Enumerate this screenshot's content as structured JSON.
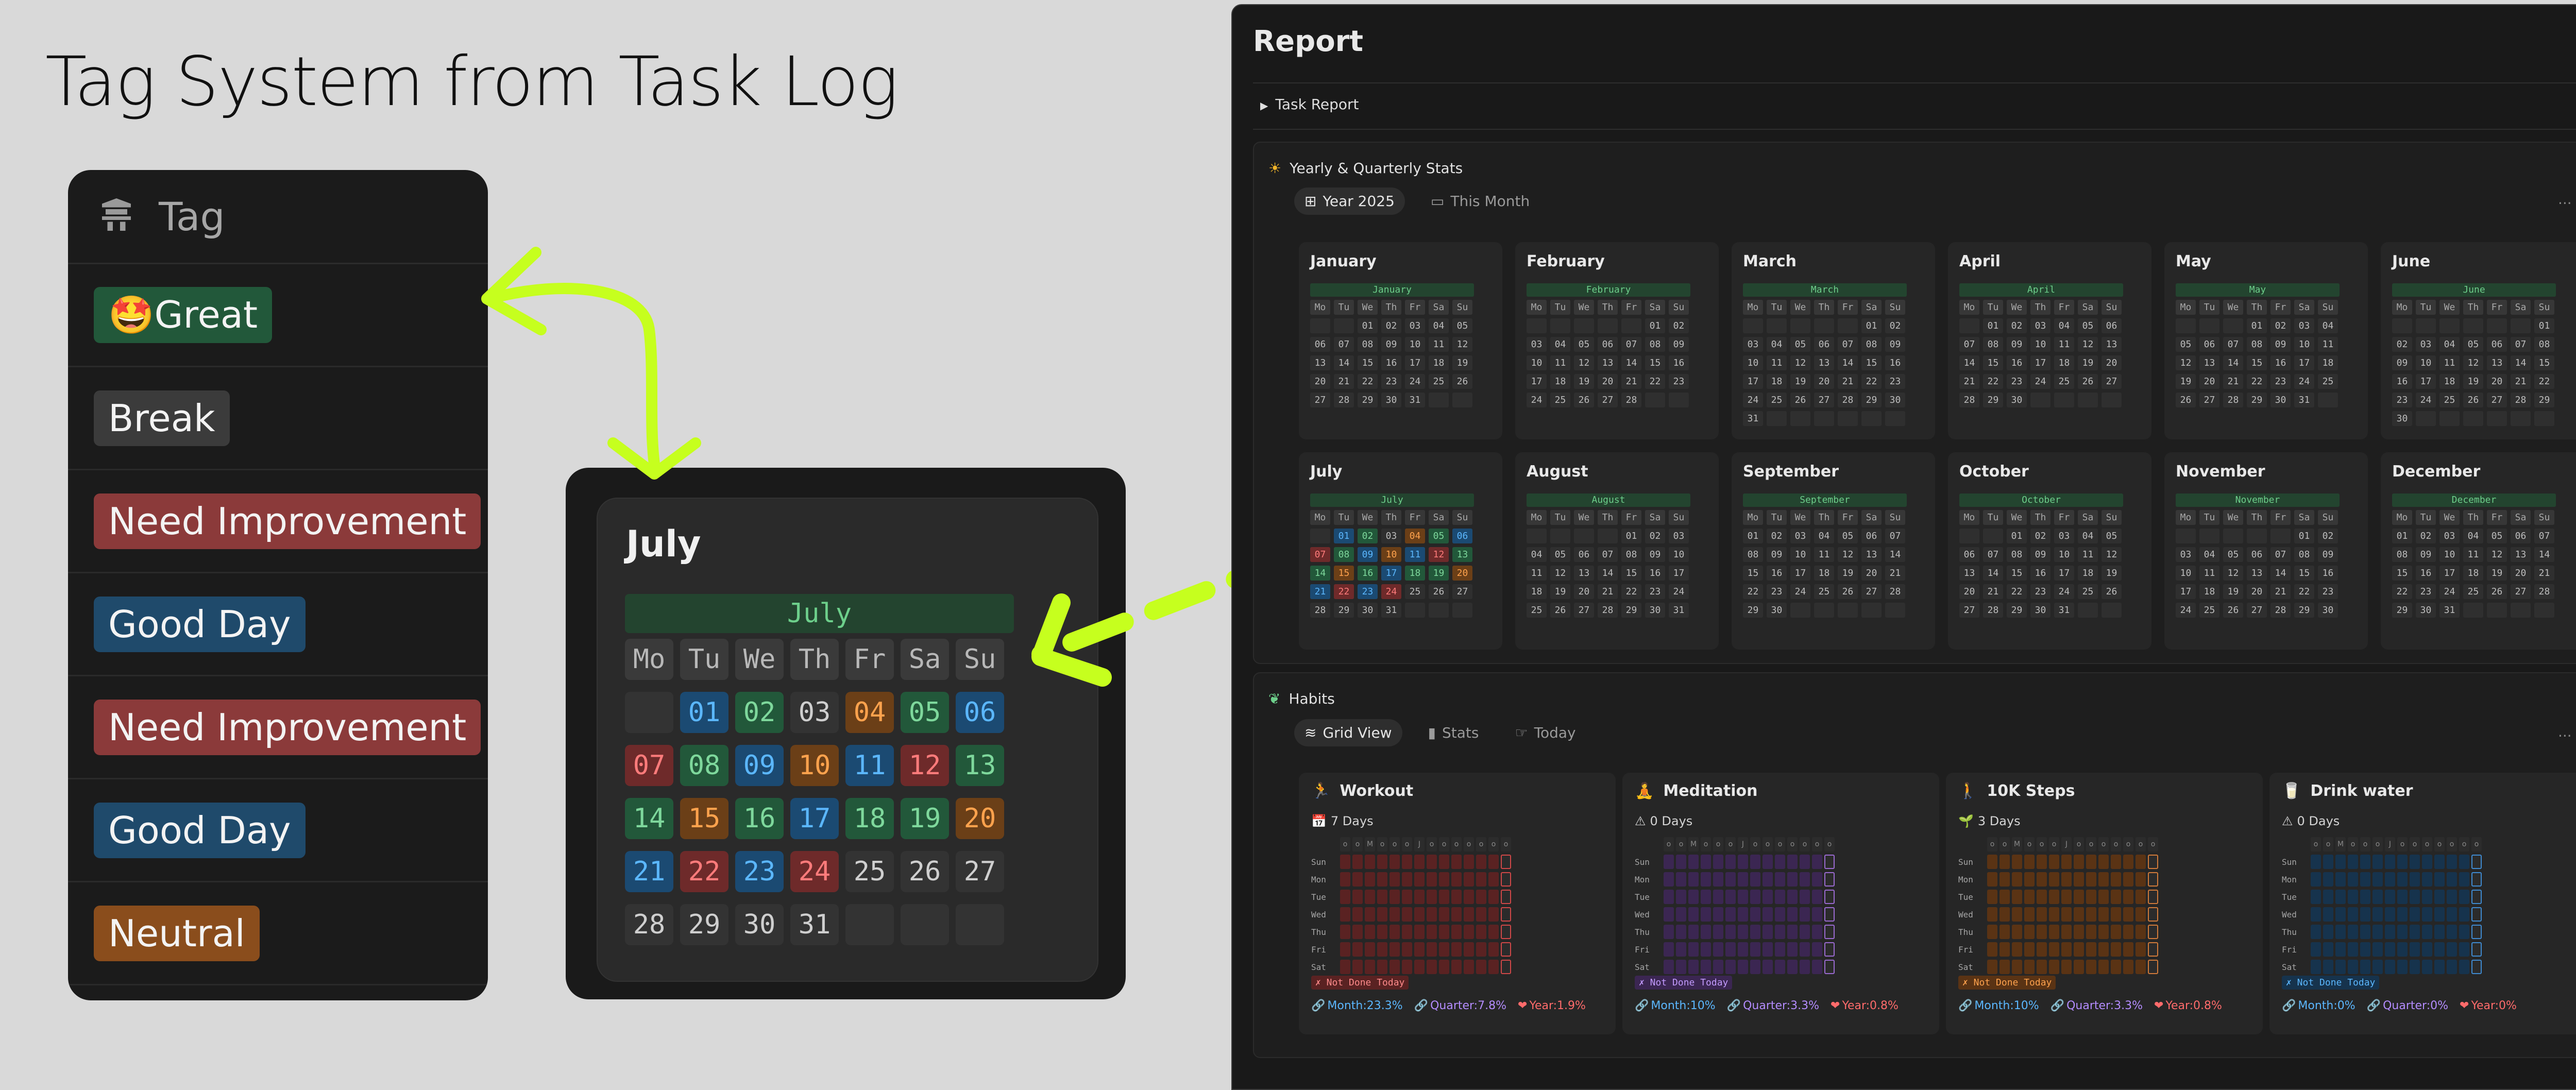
{
  "annotation": {
    "heading": "Tag System from Task Log"
  },
  "tag_column": {
    "header_label": "Tag",
    "tags": [
      {
        "label": "🤩Great",
        "color": "#22583a"
      },
      {
        "label": "Break",
        "color": "#3b3b3b"
      },
      {
        "label": "Need Improvement",
        "color": "#8b3a3a"
      },
      {
        "label": "Good Day",
        "color": "#1f4a6b"
      },
      {
        "label": "Need Improvement",
        "color": "#8b3a3a"
      },
      {
        "label": "Good Day",
        "color": "#1f4a6b"
      },
      {
        "label": "Neutral",
        "color": "#8a4d1c"
      }
    ]
  },
  "zoom_calendar": {
    "title": "July",
    "month_bar": "July",
    "weekdays": [
      "Mo",
      "Tu",
      "We",
      "Th",
      "Fr",
      "Sa",
      "Su"
    ],
    "days": [
      {
        "d": "",
        "c": ""
      },
      {
        "d": "01",
        "c": "blue"
      },
      {
        "d": "02",
        "c": "green"
      },
      {
        "d": "03",
        "c": "gray"
      },
      {
        "d": "04",
        "c": "orange"
      },
      {
        "d": "05",
        "c": "green"
      },
      {
        "d": "06",
        "c": "blue"
      },
      {
        "d": "07",
        "c": "red"
      },
      {
        "d": "08",
        "c": "green"
      },
      {
        "d": "09",
        "c": "blue"
      },
      {
        "d": "10",
        "c": "orange"
      },
      {
        "d": "11",
        "c": "blue"
      },
      {
        "d": "12",
        "c": "red"
      },
      {
        "d": "13",
        "c": "green"
      },
      {
        "d": "14",
        "c": "green"
      },
      {
        "d": "15",
        "c": "orange"
      },
      {
        "d": "16",
        "c": "green"
      },
      {
        "d": "17",
        "c": "blue"
      },
      {
        "d": "18",
        "c": "green"
      },
      {
        "d": "19",
        "c": "green"
      },
      {
        "d": "20",
        "c": "orange"
      },
      {
        "d": "21",
        "c": "blue"
      },
      {
        "d": "22",
        "c": "red"
      },
      {
        "d": "23",
        "c": "blue"
      },
      {
        "d": "24",
        "c": "red"
      },
      {
        "d": "25",
        "c": ""
      },
      {
        "d": "26",
        "c": ""
      },
      {
        "d": "27",
        "c": ""
      },
      {
        "d": "28",
        "c": ""
      },
      {
        "d": "29",
        "c": ""
      },
      {
        "d": "30",
        "c": ""
      },
      {
        "d": "31",
        "c": ""
      },
      {
        "d": "",
        "c": ""
      },
      {
        "d": "",
        "c": ""
      },
      {
        "d": "",
        "c": ""
      }
    ]
  },
  "colors": {
    "green": "#22583a",
    "green_text": "#7ed89c",
    "blue": "#1b4a72",
    "blue_text": "#5bb7ff",
    "red": "#6e2a2a",
    "red_text": "#ff7b7b",
    "orange": "#6b3f17",
    "orange_text": "#ffa24d",
    "arrow": "#c6ff1e"
  },
  "report": {
    "title": "Report",
    "toggle_label": "Task Report",
    "yearly": {
      "heading": "Yearly & Quarterly Stats",
      "tabs": [
        "Year 2025",
        "This Month"
      ],
      "weekdays": [
        "Mo",
        "Tu",
        "We",
        "Th",
        "Fr",
        "Sa",
        "Su"
      ],
      "months": [
        {
          "name": "January",
          "offset": 2,
          "days": 31
        },
        {
          "name": "February",
          "offset": 5,
          "days": 28
        },
        {
          "name": "March",
          "offset": 5,
          "days": 31
        },
        {
          "name": "April",
          "offset": 1,
          "days": 30
        },
        {
          "name": "May",
          "offset": 3,
          "days": 31
        },
        {
          "name": "June",
          "offset": 6,
          "days": 30
        },
        {
          "name": "July",
          "offset": 1,
          "days": 31
        },
        {
          "name": "August",
          "offset": 4,
          "days": 31
        },
        {
          "name": "September",
          "offset": 0,
          "days": 30
        },
        {
          "name": "October",
          "offset": 2,
          "days": 31
        },
        {
          "name": "November",
          "offset": 5,
          "days": 30
        },
        {
          "name": "December",
          "offset": 0,
          "days": 31
        }
      ]
    },
    "habits": {
      "heading": "Habits",
      "tabs": [
        "Grid View",
        "Stats",
        "Today"
      ],
      "months_row": [
        "o",
        "o",
        "M",
        "o",
        "o",
        "o",
        "J",
        "o",
        "o",
        "o",
        "o",
        "o",
        "o",
        "o"
      ],
      "day_labels": [
        "Sun",
        "Mon",
        "Tue",
        "Wed",
        "Thu",
        "Fri",
        "Sat"
      ],
      "not_done": "✗ Not Done Today",
      "cards": [
        {
          "name": "Workout",
          "icon": "🏃",
          "days": "7 Days",
          "days_icon": "📅",
          "cell": "#5a2222",
          "mark": "#d04848",
          "nd_bg": "#5a2222",
          "nd_fg": "#ff8b8b",
          "month": "Month:23.3%",
          "quarter": "Quarter:7.8%",
          "year": "Year:1.9%"
        },
        {
          "name": "Meditation",
          "icon": "🧘",
          "days": "0 Days",
          "days_icon": "⚠",
          "cell": "#3b2652",
          "mark": "#9a6ad0",
          "nd_bg": "#3b2652",
          "nd_fg": "#c39bff",
          "month": "Month:10%",
          "quarter": "Quarter:3.3%",
          "year": "Year:0.8%"
        },
        {
          "name": "10K Steps",
          "icon": "🚶",
          "days": "3 Days",
          "days_icon": "🌱",
          "cell": "#5a3314",
          "mark": "#d07a3a",
          "nd_bg": "#5a3314",
          "nd_fg": "#ffa24d",
          "month": "Month:10%",
          "quarter": "Quarter:3.3%",
          "year": "Year:0.8%"
        },
        {
          "name": "Drink water",
          "icon": "🥛",
          "days": "0 Days",
          "days_icon": "⚠",
          "cell": "#16334d",
          "mark": "#3f8ad0",
          "nd_bg": "#16334d",
          "nd_fg": "#5bb7ff",
          "month": "Month:0%",
          "quarter": "Quarter:0%",
          "year": "Year:0%"
        }
      ]
    }
  }
}
